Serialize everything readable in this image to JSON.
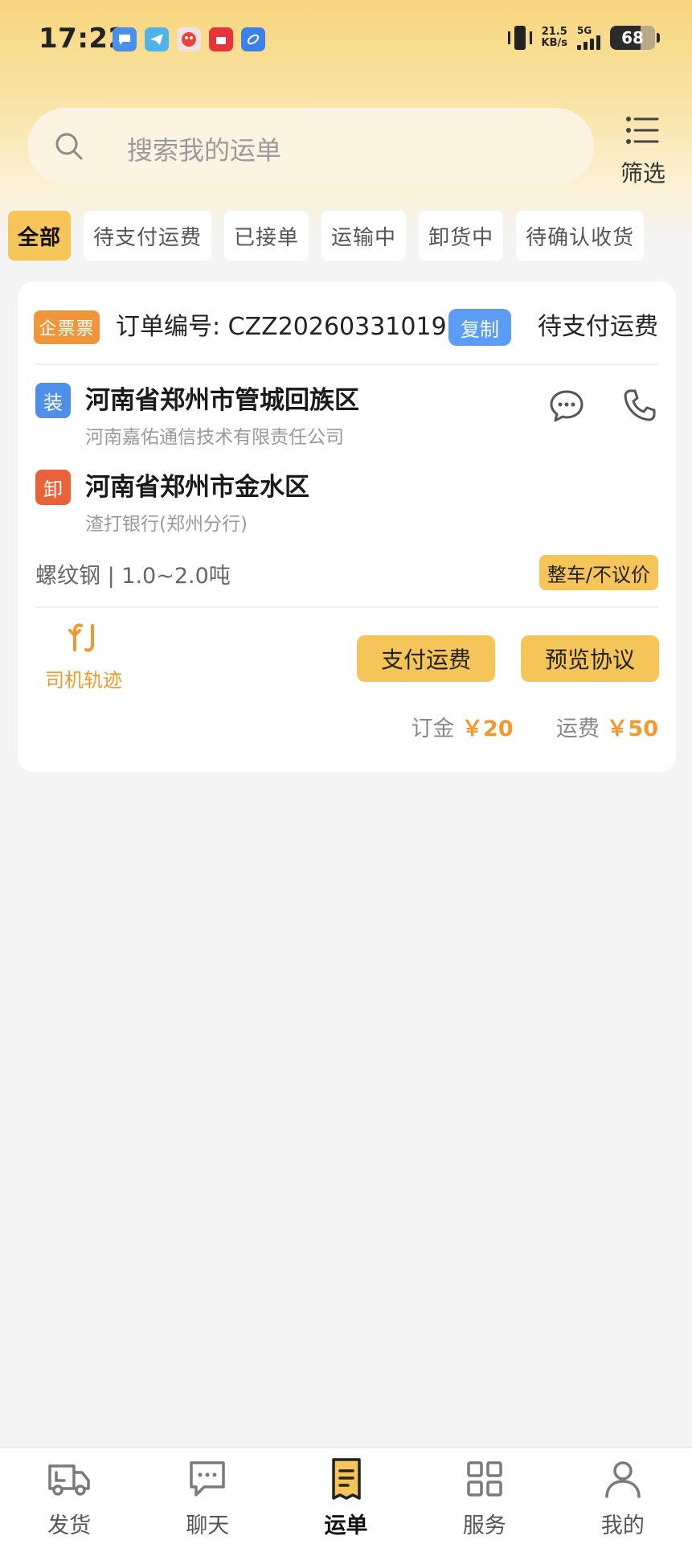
{
  "status_bar": {
    "time": "17:22",
    "net_speed_value": "21.5",
    "net_speed_unit": "KB/s",
    "network": "5G",
    "battery": "68",
    "app_icons": [
      "message-app-icon",
      "telegram-icon",
      "game-app-icon",
      "shopping-app-icon",
      "browser-app-icon"
    ]
  },
  "search": {
    "placeholder": "搜索我的运单"
  },
  "filter": {
    "label": "筛选"
  },
  "tabs": [
    {
      "label": "全部",
      "active": true
    },
    {
      "label": "待支付运费",
      "active": false
    },
    {
      "label": "已接单",
      "active": false
    },
    {
      "label": "运输中",
      "active": false
    },
    {
      "label": "卸货中",
      "active": false
    },
    {
      "label": "待确认收货",
      "active": false
    }
  ],
  "order": {
    "invoice_badge": "企票票",
    "order_number": "订单编号: CZZ20260331019",
    "copy_label": "复制",
    "status": "待支付运费",
    "load_tag": "装",
    "load_address": "河南省郑州市管城回族区",
    "load_company": "河南嘉佑通信技术有限责任公司",
    "unload_tag": "卸",
    "unload_address": "河南省郑州市金水区",
    "unload_company": "渣打银行(郑州分行)",
    "cargo": "螺纹钢 | 1.0~2.0吨",
    "price_mode": "整车/不议价",
    "track_label": "司机轨迹",
    "pay_button": "支付运费",
    "preview_button": "预览协议",
    "deposit_label": "订金",
    "deposit_amount": "￥20",
    "freight_label": "运费",
    "freight_amount": "￥50"
  },
  "bottom_nav": [
    {
      "label": "发货",
      "icon": "truck-icon",
      "active": false
    },
    {
      "label": "聊天",
      "icon": "chat-bubble-icon",
      "active": false
    },
    {
      "label": "运单",
      "icon": "waybill-icon",
      "active": true
    },
    {
      "label": "服务",
      "icon": "grid-icon",
      "active": false
    },
    {
      "label": "我的",
      "icon": "person-icon",
      "active": false
    }
  ],
  "colors": {
    "accent": "#f5c55a",
    "orange": "#f09a2e",
    "load_blue": "#4f8fe8",
    "unload_red": "#e8623a",
    "copy_blue": "#5b9cf5"
  }
}
